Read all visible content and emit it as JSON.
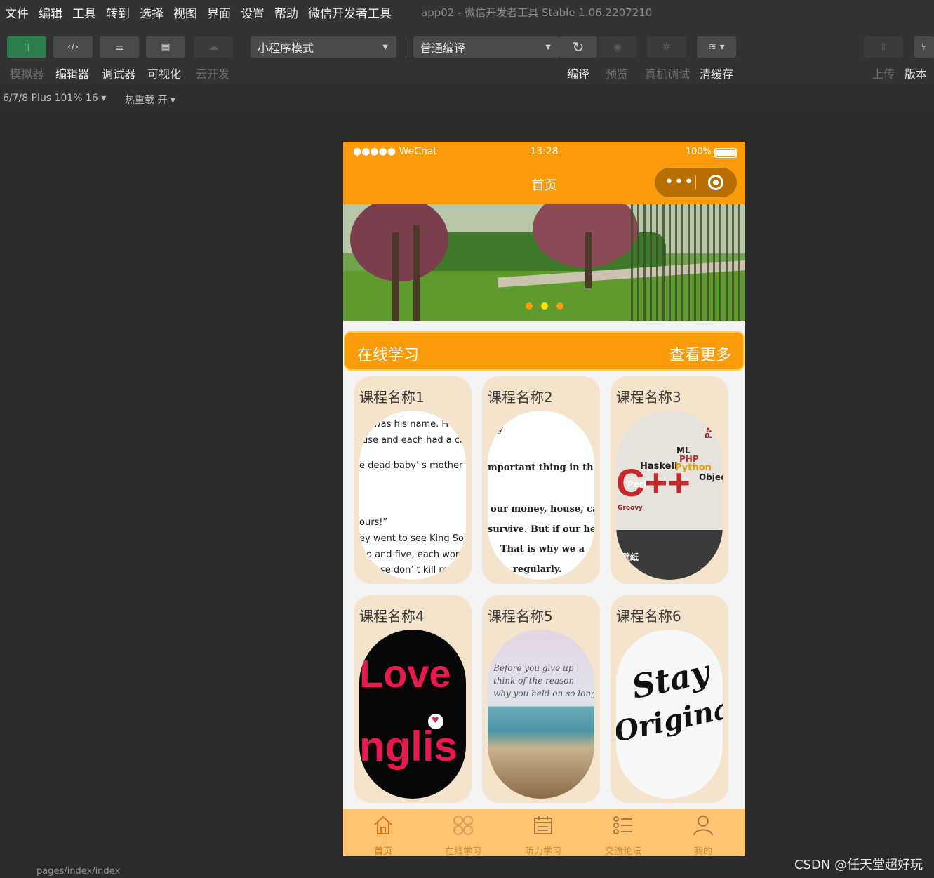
{
  "menu": {
    "items": [
      "文件",
      "编辑",
      "工具",
      "转到",
      "选择",
      "视图",
      "界面",
      "设置",
      "帮助",
      "微信开发者工具"
    ],
    "window_title": "app02 - 微信开发者工具 Stable 1.06.2207210"
  },
  "toolbar": {
    "simulator": "模拟器",
    "editor": "编辑器",
    "debugger": "调试器",
    "visual": "可视化",
    "cloud": "云开发",
    "mode_select": "小程序模式",
    "compile_select": "普通编译",
    "compile": "编译",
    "preview": "预览",
    "real_debug": "真机调试",
    "clear_cache": "清缓存",
    "upload": "上传",
    "version": "版本"
  },
  "subbar": {
    "device": "6/7/8 Plus 101% 16 ▾",
    "hot_reload": "热重载 开 ▾"
  },
  "phone": {
    "carrier": "●●●●● WeChat",
    "time": "13:28",
    "battery": "100%",
    "nav_title": "首页",
    "capsule_dots": "•••",
    "section_left": "在线学习",
    "section_right": "查看更多",
    "courses": [
      {
        "name": "课程名称1"
      },
      {
        "name": "课程名称2"
      },
      {
        "name": "课程名称3"
      },
      {
        "name": "课程名称4"
      },
      {
        "name": "课程名称5"
      },
      {
        "name": "课程名称6"
      }
    ],
    "course1_lines": [
      "was his name. H",
      "use and each had a chil",
      "e dead baby’ s mother to",
      "ours!”",
      "ey went to see King Solo",
      "o and five, each woma",
      "se don’ t kill m"
    ],
    "course2_lines": [
      "y",
      "mportant thing in the",
      "our money, house, car",
      "survive. But if our hea",
      "That is why we a",
      "regularly."
    ],
    "course3_words": {
      "ml": "ML",
      "php": "PHP",
      "haskell": "Haskell",
      "python": "Python",
      "perl": "Perl",
      "object": "Objec",
      "groovy": "Groovy",
      "pascal": "Pascal",
      "c": "C++",
      "wall": "壁纸"
    },
    "course4_words": {
      "love": "Love",
      "english": "nglis"
    },
    "course5_lines": [
      "Before you give up",
      "think of the reason",
      "why you held on so long"
    ],
    "course6_words": {
      "stay": "Stay",
      "original": "Original"
    },
    "tabs": [
      {
        "label": "首页",
        "icon": "home-icon"
      },
      {
        "label": "在线学习",
        "icon": "grid-icon"
      },
      {
        "label": "听力学习",
        "icon": "calendar-icon"
      },
      {
        "label": "交流论坛",
        "icon": "list-icon"
      },
      {
        "label": "我的",
        "icon": "user-icon"
      }
    ]
  },
  "statusline": {
    "path": "pages/index/index"
  },
  "watermark": "CSDN @任天堂超好玩",
  "colors": {
    "accent": "#fa9b0c",
    "tabbar": "#fec471",
    "card": "#f5e4cc"
  }
}
